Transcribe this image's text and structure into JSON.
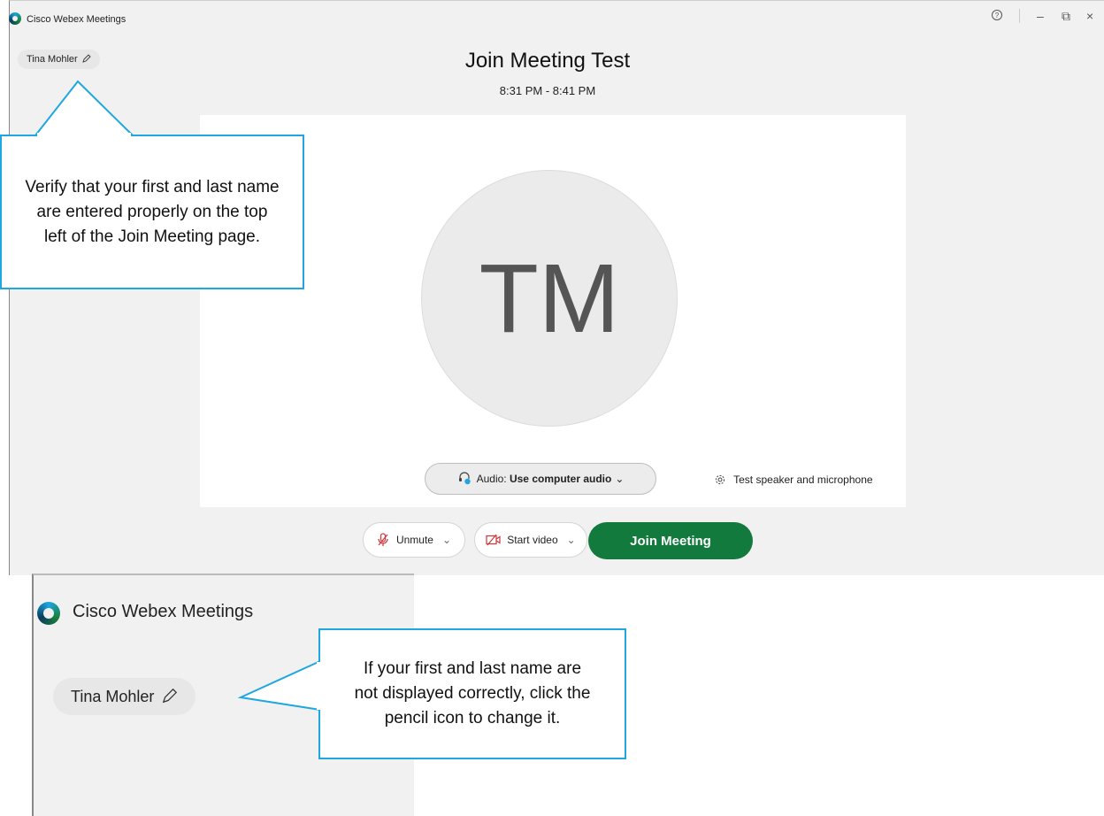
{
  "window": {
    "title": "Cisco Webex Meetings",
    "controls": {
      "help": "⊘",
      "minimize": "–",
      "restore": "⧉",
      "close": "×"
    }
  },
  "user_name": "Tina Mohler",
  "meeting": {
    "title": "Join Meeting Test",
    "time": "8:31 PM - 8:41 PM",
    "avatar_initials": "TM"
  },
  "audio": {
    "label": "Audio:",
    "value": "Use computer audio",
    "test_link": "Test speaker and microphone"
  },
  "controls": {
    "unmute": "Unmute",
    "start_video": "Start video",
    "join": "Join Meeting"
  },
  "callouts": {
    "verify": "Verify that your first and last name are entered properly on the top left of the Join Meeting page.",
    "pencil": "If your first and last name are not displayed correctly, click the pencil icon to change it."
  },
  "colors": {
    "join_green": "#127a3c",
    "callout_blue": "#1ea7e0",
    "mute_red": "#d0363a"
  }
}
